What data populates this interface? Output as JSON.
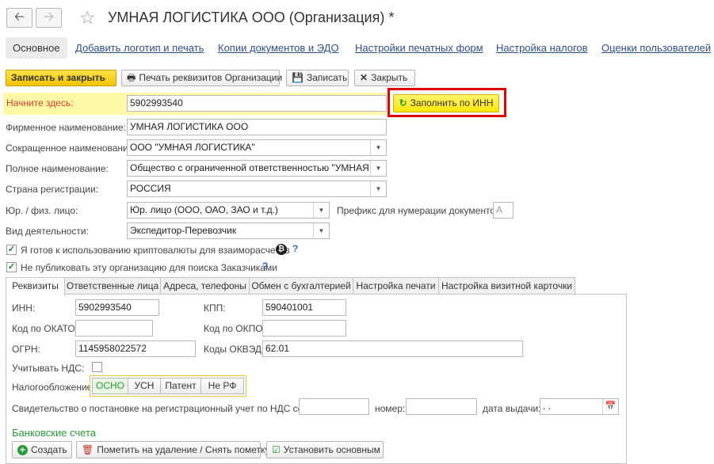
{
  "window": {
    "title": "УМНАЯ ЛОГИСТИКА ООО (Организация) *"
  },
  "nav": {
    "back_icon": "arrow-left-icon",
    "forward_icon": "arrow-right-icon",
    "favorite_icon": "star-icon"
  },
  "top_links": {
    "main": "Основное",
    "items": [
      "Добавить логотип и печать",
      "Копии документов и ЭДО",
      "Настройки печатных форм",
      "Настройка налогов",
      "Оценки пользователей"
    ]
  },
  "toolbar": {
    "save_close": "Записать и закрыть",
    "print_details": "Печать реквизитов Организации",
    "save": "Записать",
    "close": "Закрыть"
  },
  "start": {
    "label": "Начните здесь:",
    "value": "5902993540",
    "fill_button": "Заполнить по ИНН"
  },
  "form": {
    "firm_name": {
      "label": "Фирменное наименование:",
      "value": "УМНАЯ ЛОГИСТИКА ООО"
    },
    "short_name": {
      "label": "Сокращенное наименование:",
      "value": "ООО \"УМНАЯ ЛОГИСТИКА\""
    },
    "full_name": {
      "label": "Полное наименование:",
      "value": "Общество с ограниченной ответственностью \"УМНАЯ ЛОГИ"
    },
    "country": {
      "label": "Страна регистрации:",
      "value": "РОССИЯ"
    },
    "entity_type": {
      "label": "Юр. / физ. лицо:",
      "value": "Юр. лицо (ООО, ОАО, ЗАО и т.д.)"
    },
    "prefix": {
      "label": "Префикс для нумерации документов :",
      "value": "А"
    },
    "activity": {
      "label": "Вид деятельности:",
      "value": "Экспедитор-Перевозчик"
    },
    "crypto": {
      "label": "Я готов к использованию криптовалюты для взаиморасчетов",
      "checked": true
    },
    "no_publish": {
      "label": "Не публиковать эту организацию для поиска Заказчиками",
      "checked": true
    },
    "help_mark": "?"
  },
  "tabs": [
    "Реквизиты",
    "Ответственные лица",
    "Адреса, телефоны",
    "Обмен с бухгалтерией",
    "Настройка печати",
    "Настройка визитной карточки"
  ],
  "requisites": {
    "inn": {
      "label": "ИНН:",
      "value": "5902993540"
    },
    "kpp": {
      "label": "КПП:",
      "value": "590401001"
    },
    "okato": {
      "label": "Код по ОКАТО:",
      "value": ""
    },
    "okpo": {
      "label": "Код по ОКПО:",
      "value": ""
    },
    "ogrn": {
      "label": "ОГРН:",
      "value": "1145958022572"
    },
    "okved": {
      "label": "Коды ОКВЭД:",
      "value": "62.01"
    },
    "vat": {
      "label": "Учитывать НДС:",
      "checked": false
    },
    "taxation": {
      "label": "Налогообложение:",
      "options": [
        "ОСНО",
        "УСН",
        "Патент",
        "Не РФ"
      ],
      "selected": "ОСНО"
    },
    "certificate": {
      "label": "Свидетельство о постановке на регистрационный учет по НДС серия:",
      "number_label": "номер:",
      "date_label": "дата выдачи:",
      "date_value": " .  ."
    }
  },
  "bank": {
    "title": "Банковские счета",
    "create": "Создать",
    "mark_delete": "Пометить на удаление / Снять пометку",
    "set_main": "Установить основным"
  },
  "colors": {
    "accent_yellow": "#ffe40a",
    "highlight_red": "#e00000",
    "link_blue": "#2d4e8a",
    "green": "#2a9a3a"
  }
}
